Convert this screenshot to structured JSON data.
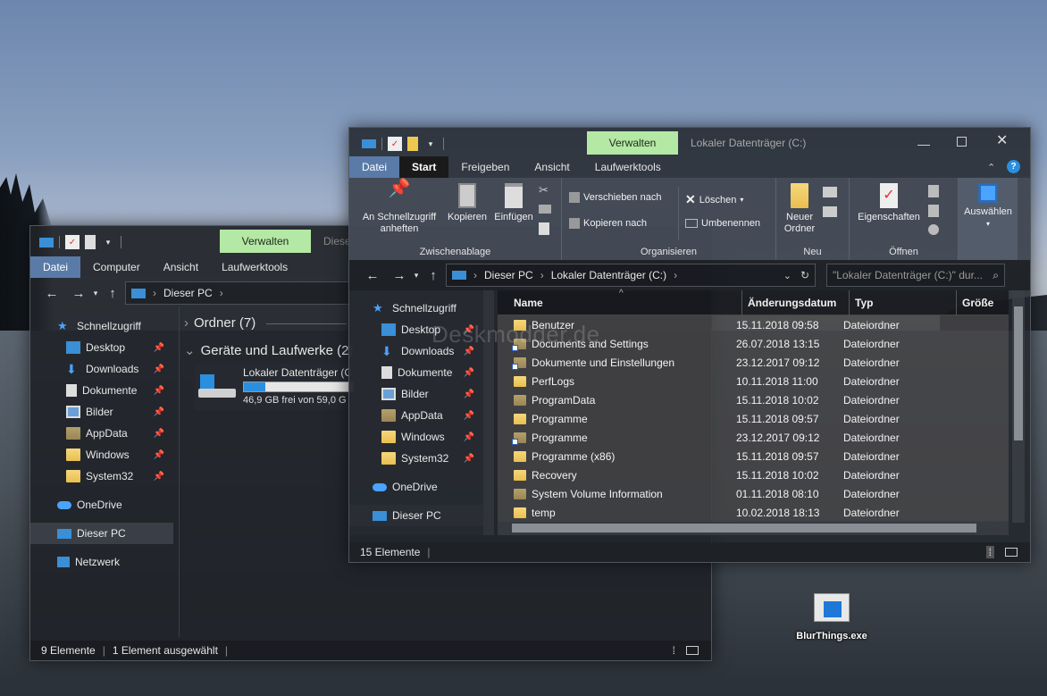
{
  "desktop": {
    "icon_label": "BlurThings.exe"
  },
  "back_window": {
    "context_tab": "Verwalten",
    "title_partial": "Diese",
    "ribbon_tabs": [
      "Datei",
      "Computer",
      "Ansicht",
      "Laufwerktools"
    ],
    "address": "Dieser PC",
    "nav": {
      "quick": "Schnellzugriff",
      "items": [
        "Desktop",
        "Downloads",
        "Dokumente",
        "Bilder",
        "AppData",
        "Windows",
        "System32"
      ],
      "onedrive": "OneDrive",
      "thispc": "Dieser PC",
      "network": "Netzwerk"
    },
    "groups": {
      "folders": "Ordner (7)",
      "drives": "Geräte und Laufwerke (2)"
    },
    "drive": {
      "name": "Lokaler Datenträger (C",
      "free": "46,9 GB frei von 59,0 G",
      "used_fraction": 0.2
    },
    "status": {
      "count": "9 Elemente",
      "selected": "1 Element ausgewählt"
    }
  },
  "front_window": {
    "context_tab": "Verwalten",
    "title": "Lokaler Datenträger (C:)",
    "ribbon_tabs": [
      "Datei",
      "Start",
      "Freigeben",
      "Ansicht",
      "Laufwerktools"
    ],
    "ribbon": {
      "pin": "An Schnellzugriff anheften",
      "copy": "Kopieren",
      "paste": "Einfügen",
      "clipboard_group": "Zwischenablage",
      "move_to": "Verschieben nach",
      "copy_to": "Kopieren nach",
      "delete": "Löschen",
      "rename": "Umbenennen",
      "organize_group": "Organisieren",
      "new_folder": "Neuer Ordner",
      "new_group": "Neu",
      "properties": "Eigenschaften",
      "open_group": "Öffnen",
      "select": "Auswählen"
    },
    "address": {
      "seg1": "Dieser PC",
      "seg2": "Lokaler Datenträger (C:)",
      "search_placeholder": "\"Lokaler Datenträger (C:)\" dur..."
    },
    "nav": {
      "quick": "Schnellzugriff",
      "items": [
        "Desktop",
        "Downloads",
        "Dokumente",
        "Bilder",
        "AppData",
        "Windows",
        "System32"
      ],
      "onedrive": "OneDrive",
      "thispc": "Dieser PC"
    },
    "columns": [
      "Name",
      "Änderungsdatum",
      "Typ",
      "Größe"
    ],
    "files": [
      {
        "name": "Benutzer",
        "date": "15.11.2018 09:58",
        "type": "Dateiordner"
      },
      {
        "name": "Documents and Settings",
        "date": "26.07.2018 13:15",
        "type": "Dateiordner"
      },
      {
        "name": "Dokumente und Einstellungen",
        "date": "23.12.2017 09:12",
        "type": "Dateiordner"
      },
      {
        "name": "PerfLogs",
        "date": "10.11.2018 11:00",
        "type": "Dateiordner"
      },
      {
        "name": "ProgramData",
        "date": "15.11.2018 10:02",
        "type": "Dateiordner"
      },
      {
        "name": "Programme",
        "date": "15.11.2018 09:57",
        "type": "Dateiordner"
      },
      {
        "name": "Programme",
        "date": "23.12.2017 09:12",
        "type": "Dateiordner"
      },
      {
        "name": "Programme (x86)",
        "date": "15.11.2018 09:57",
        "type": "Dateiordner"
      },
      {
        "name": "Recovery",
        "date": "15.11.2018 10:02",
        "type": "Dateiordner"
      },
      {
        "name": "System Volume Information",
        "date": "01.11.2018 08:10",
        "type": "Dateiordner"
      },
      {
        "name": "temp",
        "date": "10.02.2018 18:13",
        "type": "Dateiordner"
      }
    ],
    "status": "15 Elemente",
    "watermark": "Deskmodder.de"
  }
}
